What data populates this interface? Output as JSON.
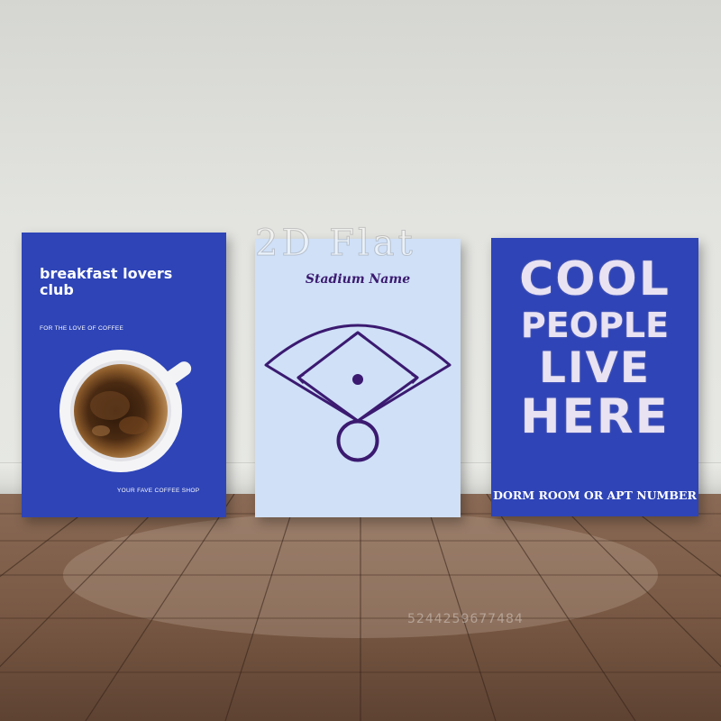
{
  "scene": "three posters leaning against a wall on a wooden floor",
  "posters": {
    "breakfast": {
      "title": "breakfast lovers club",
      "subtitle": "FOR THE LOVE OF COFFEE",
      "footer": "YOUR FAVE COFFEE SHOP",
      "background_color": "#2e44b7",
      "image": "coffee-cup-topview"
    },
    "stadium": {
      "title": "Stadium Name",
      "background_color": "#cfe0f7",
      "line_color": "#3b1a70",
      "image": "baseball-diamond"
    },
    "cool": {
      "lines": [
        "COOL",
        "PEOPLE",
        "LIVE",
        "HERE"
      ],
      "footer": "DORM ROOM OR APT NUMBER",
      "background_color": "#2e44b7",
      "text_color": "#e8e2f2"
    }
  },
  "watermarks": {
    "brand": "2D Flat",
    "code": "5244259677484"
  }
}
